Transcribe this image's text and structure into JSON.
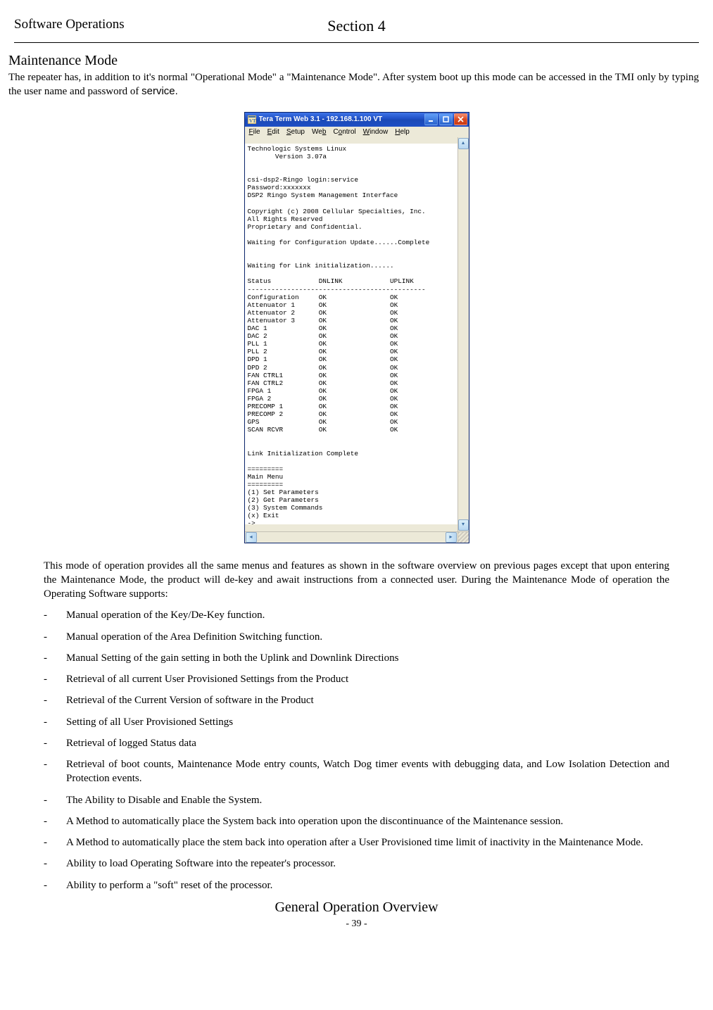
{
  "header": {
    "left": "Software Operations",
    "center": "Section  4"
  },
  "heading": "Maintenance  Mode",
  "intro_before_service": "The repeater has, in addition to it's normal \"Operational Mode\" a \"Maintenance Mode\".  After system boot up this mode can be accessed in the TMI only by typing the user  name and  password of ",
  "intro_service": "service.",
  "window": {
    "title": "Tera Term Web 3.1 - 192.168.1.100 VT",
    "menus": [
      "File",
      "Edit",
      "Setup",
      "Web",
      "Control",
      "Window",
      "Help"
    ]
  },
  "terminal_lines": [
    "Technologic Systems Linux",
    "       Version 3.07a",
    "",
    "",
    "csi-dsp2-Ringo login:service",
    "Password:xxxxxxx",
    "DSP2 Ringo System Management Interface",
    "",
    "Copyright (c) 2008 Cellular Specialties, Inc.",
    "All Rights Reserved",
    "Proprietary and Confidential.",
    "",
    "Waiting for Configuration Update......Complete",
    "",
    "",
    "Waiting for Link initialization......",
    "",
    "Status            DNLINK            UPLINK",
    "---------------------------------------------",
    "Configuration     OK                OK",
    "Attenuator 1      OK                OK",
    "Attenuator 2      OK                OK",
    "Attenuator 3      OK                OK",
    "DAC 1             OK                OK",
    "DAC 2             OK                OK",
    "PLL 1             OK                OK",
    "PLL 2             OK                OK",
    "DPD 1             OK                OK",
    "DPD 2             OK                OK",
    "FAN CTRL1         OK                OK",
    "FAN CTRL2         OK                OK",
    "FPGA 1            OK                OK",
    "FPGA 2            OK                OK",
    "PRECOMP 1         OK                OK",
    "PRECOMP 2         OK                OK",
    "GPS               OK                OK",
    "SCAN RCVR         OK                OK",
    "",
    "",
    "Link Initialization Complete",
    "",
    "=========",
    "Main Menu",
    "=========",
    "(1) Set Parameters",
    "(2) Get Parameters",
    "(3) System Commands",
    "(x) Exit",
    "->"
  ],
  "after_para": "This mode of operation provides all the same menus and features as shown in the software overview on previous pages except that upon entering the Maintenance Mode, the product will de-key and await instructions from a connected user.   During the Maintenance Mode of operation the Operating Software supports:",
  "bullets": [
    "Manual operation of the Key/De-Key function.",
    "Manual operation of the Area Definition Switching function.",
    "Manual Setting of the gain setting in both the Uplink and Downlink Directions",
    "Retrieval of all current  User Provisioned Settings from the Product",
    "Retrieval of the Current  Version of software in the Product",
    "Setting of all User Provisioned Settings",
    "Retrieval of logged Status data",
    "Retrieval of boot counts, Maintenance Mode entry counts, Watch Dog timer events with debugging data, and Low Isolation Detection and Protection events.",
    "The Ability to Disable and Enable the System.",
    "A Method to automatically place the System back into operation upon the discontinuance of the Maintenance session.",
    "A Method to automatically place the stem back into operation after a User Provisioned time limit of inactivity in the Maintenance Mode.",
    "Ability to load Operating Software into the repeater's processor.",
    "Ability to perform a \"soft\" reset of the processor."
  ],
  "footer": {
    "title": "General  Operation  Overview",
    "page": "- 39 -"
  }
}
